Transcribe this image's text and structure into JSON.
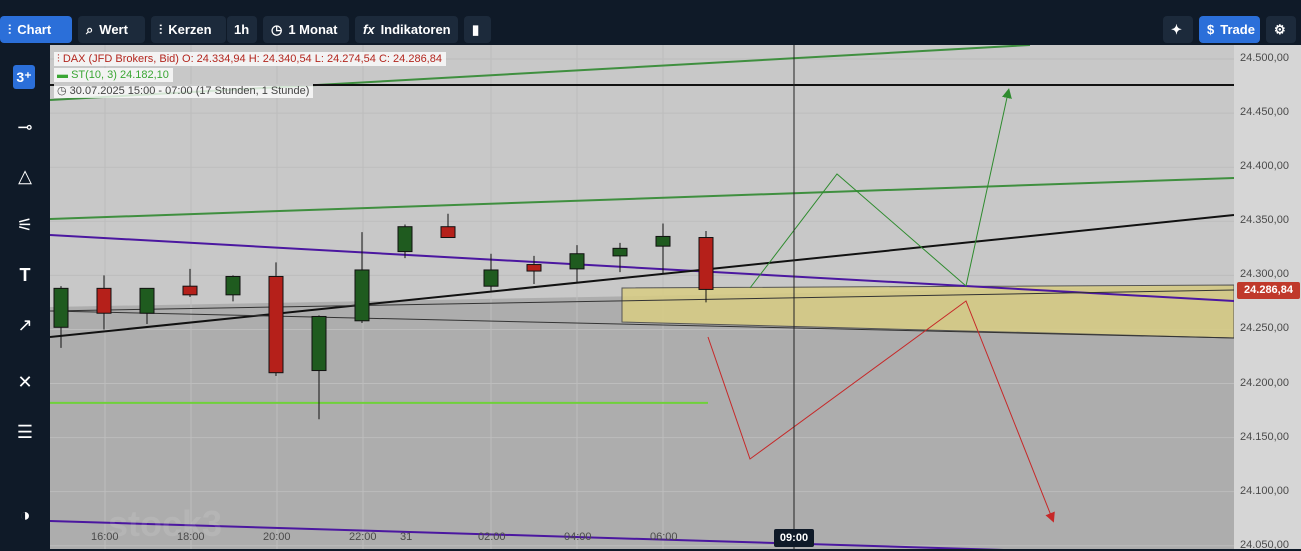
{
  "toolbar": {
    "chart_label": "Chart",
    "value_label": "Wert",
    "chart_type_label": "Kerzen",
    "interval_label": "1h",
    "range_label": "1 Monat",
    "indicators_label": "Indikatoren",
    "trade_label": "Trade"
  },
  "sidebar": {
    "icons": [
      "logo-icon",
      "crosshair-tool-icon",
      "triangle-shape-icon",
      "trendline-tools-icon",
      "text-tool-icon",
      "annotation-tool-icon",
      "settings-tools-icon",
      "object-list-icon",
      "theme-toggle-icon"
    ]
  },
  "legend": {
    "instrument": "DAX (JFD Brokers, Bid)",
    "open": "O: 24.334,94",
    "high": "H: 24.340,54",
    "low": "L: 24.274,54",
    "close": "C: 24.286,84",
    "indicator": "ST(10, 3)",
    "indicator_value": "24.182,10",
    "timeframe": "30.07.2025 15:00 - 07:00",
    "duration": "(17 Stunden, 1 Stunde)"
  },
  "price_axis": {
    "labels": [
      "24.500,00",
      "24.450,00",
      "24.400,00",
      "24.350,00",
      "24.300,00",
      "24.250,00",
      "24.200,00",
      "24.150,00",
      "24.100,00",
      "24.050,00"
    ],
    "current_price": "24.286,84"
  },
  "time_axis": {
    "labels": [
      "16:00",
      "18:00",
      "20:00",
      "22:00",
      "31",
      "02:00",
      "04:00",
      "06:00"
    ],
    "crosshair_time": "09:00"
  },
  "watermark": "stock3",
  "colors": {
    "bull": "#1f5b1f",
    "bear": "#b5201a",
    "supertrend": "#6fd13a",
    "accent": "#2b6fd9",
    "trend_green": "#3f8f3f",
    "trend_purple": "#4b17a0",
    "zone": "#d8cc82"
  },
  "chart_data": {
    "type": "candlestick",
    "interval": "1h",
    "ylim": [
      24047,
      24513
    ],
    "y_ticks": [
      24500,
      24450,
      24400,
      24350,
      24300,
      24250,
      24200,
      24150,
      24100,
      24050
    ],
    "candles": [
      {
        "o": 24252,
        "h": 24290,
        "l": 24233,
        "c": 24288
      },
      {
        "o": 24288,
        "h": 24300,
        "l": 24250,
        "c": 24265
      },
      {
        "o": 24265,
        "h": 24288,
        "l": 24255,
        "c": 24288
      },
      {
        "o": 24290,
        "h": 24306,
        "l": 24280,
        "c": 24282
      },
      {
        "o": 24282,
        "h": 24300,
        "l": 24276,
        "c": 24299
      },
      {
        "o": 24299,
        "h": 24312,
        "l": 24207,
        "c": 24210
      },
      {
        "o": 24212,
        "h": 24263,
        "l": 24167,
        "c": 24262
      },
      {
        "o": 24258,
        "h": 24340,
        "l": 24256,
        "c": 24305
      },
      {
        "o": 24322,
        "h": 24347,
        "l": 24316,
        "c": 24345
      },
      {
        "o": 24345,
        "h": 24357,
        "l": 24335,
        "c": 24335
      },
      {
        "o": 24290,
        "h": 24320,
        "l": 24286,
        "c": 24305
      },
      {
        "o": 24310,
        "h": 24318,
        "l": 24292,
        "c": 24304
      },
      {
        "o": 24306,
        "h": 24328,
        "l": 24294,
        "c": 24320
      },
      {
        "o": 24318,
        "h": 24330,
        "l": 24303,
        "c": 24325
      },
      {
        "o": 24327,
        "h": 24348,
        "l": 24302,
        "c": 24336
      },
      {
        "o": 24335,
        "h": 24341,
        "l": 24275,
        "c": 24287
      }
    ],
    "supertrend": {
      "name": "ST(10, 3)",
      "value": 24182.1
    },
    "current_price": 24286.84
  }
}
